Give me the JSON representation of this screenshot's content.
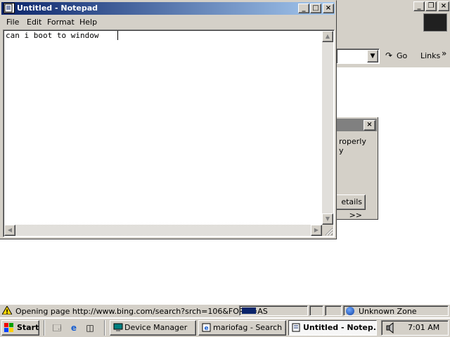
{
  "background_window": {
    "toolbar": {
      "go_label": "Go",
      "links_label": "Links",
      "links_chevron": "»"
    },
    "error_dialog": {
      "close_glyph": "×",
      "partial_text_line1": "roperly",
      "partial_text_line2": "y",
      "details_label": "etails >>"
    }
  },
  "notepad": {
    "title": "Untitled - Notepad",
    "menu": [
      "File",
      "Edit",
      "Format",
      "Help"
    ],
    "content": "can i boot to window",
    "controls": {
      "minimize": "_",
      "maximize": "□",
      "close": "×"
    }
  },
  "statusbar": {
    "text": "Opening page http://www.bing.com/search?srch=106&FORM=AS",
    "progress_fraction": 0.22,
    "zone": "Unknown Zone"
  },
  "taskbar": {
    "start_label": "Start",
    "tasks": [
      {
        "label": "Device Manager",
        "active": false
      },
      {
        "label": "mariofag - Search ...",
        "active": false
      },
      {
        "label": "Untitled - Notep...",
        "active": true
      }
    ],
    "clock": "7:01 AM"
  },
  "colors": {
    "title_active": "#0a246a",
    "title_gradient_end": "#a6caf0",
    "face": "#d4d0c8"
  },
  "icons": [
    "notepad-icon",
    "warning-icon",
    "globe-icon",
    "windows-logo-icon",
    "desktop-icon",
    "ie-icon",
    "channels-icon",
    "device-manager-icon",
    "speaker-icon"
  ]
}
